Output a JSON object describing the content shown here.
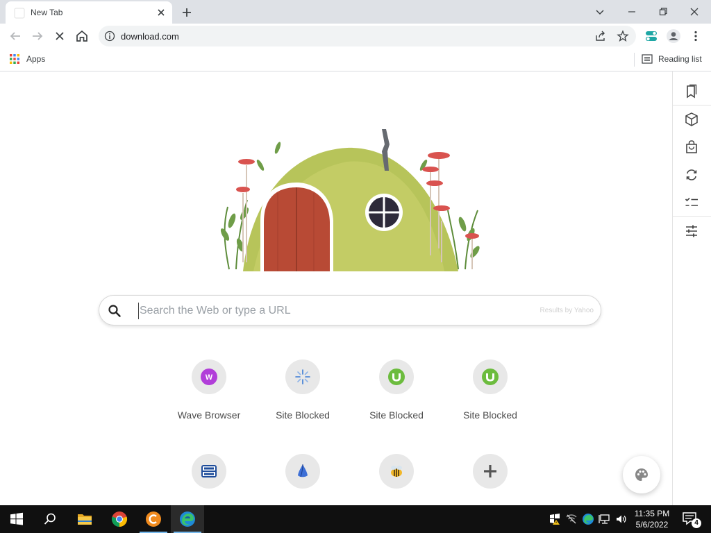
{
  "tab": {
    "title": "New Tab"
  },
  "toolbar": {
    "url": "download.com"
  },
  "bookmarks": {
    "apps_label": "Apps",
    "reading_list_label": "Reading list"
  },
  "search": {
    "placeholder": "Search the Web or type a URL",
    "value": "",
    "results_by": "Results by Yahoo"
  },
  "shortcuts": [
    {
      "label": "Wave Browser",
      "icon": "wave-browser-icon"
    },
    {
      "label": "Site Blocked",
      "icon": "blocked-site-icon"
    },
    {
      "label": "Site Blocked",
      "icon": "utorrent-icon"
    },
    {
      "label": "Site Blocked",
      "icon": "utorrent-icon"
    },
    {
      "label": "",
      "icon": "free-mp3-icon"
    },
    {
      "label": "",
      "icon": "blue-app-icon"
    },
    {
      "label": "",
      "icon": "bee-app-icon"
    },
    {
      "label": "",
      "icon": "add-shortcut-icon"
    }
  ],
  "sidepanel": {
    "icons": [
      "bookmark-icon",
      "cube-icon",
      "shopping-bag-icon",
      "refresh-icon",
      "checklist-icon",
      "sliders-icon"
    ]
  },
  "taskbar": {
    "apps": [
      "start-icon",
      "search-icon",
      "file-explorer-icon",
      "chrome-icon",
      "ccleaner-icon",
      "edge-icon"
    ],
    "time": "11:35 PM",
    "date": "5/6/2022",
    "notification_count": "4"
  },
  "colors": {
    "chrome_frame": "#dee1e6",
    "omnibox": "#f1f3f4",
    "taskbar": "#101010",
    "wave_purple": "#b13ed9",
    "utorrent_green": "#6cbc3e"
  }
}
